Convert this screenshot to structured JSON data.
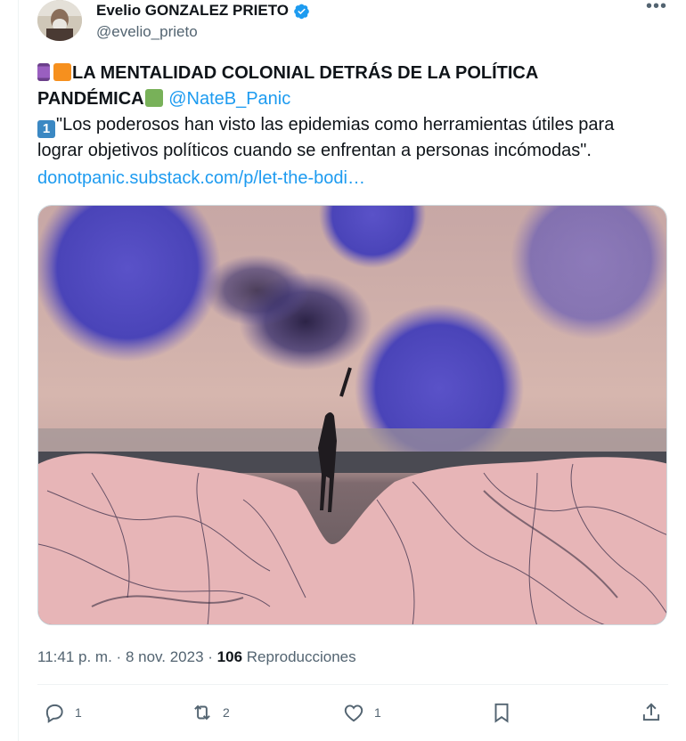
{
  "author": {
    "display_name": "Evelio GONZALEZ PRIETO",
    "handle": "@evelio_prieto",
    "verified": true
  },
  "tweet": {
    "headline_line1": "LA MENTALIDAD COLONIAL DETRÁS DE LA POLÍTICA",
    "headline_line2": "PANDÉMICA",
    "mention": "@NateB_Panic",
    "quote": "\"Los poderosos han visto las epidemias como herramientas útiles para lograr objetivos políticos cuando se enfrentan a personas incómodas\".",
    "link": "donotpanic.substack.com/p/let-the-bodi…",
    "emoji_icons": [
      "spool-emoji-icon",
      "orange-square-icon",
      "green-square-icon",
      "keycap-one-icon"
    ]
  },
  "meta": {
    "time": "11:41 p. m.",
    "separator": "·",
    "date": "8 nov. 2023",
    "views_count": "106",
    "views_label": "Reproducciones"
  },
  "actions": {
    "replies": "1",
    "retweets": "2",
    "likes": "1"
  },
  "colors": {
    "accent": "#1d9bf0",
    "secondary_text": "#536471",
    "primary_text": "#0f1419"
  }
}
